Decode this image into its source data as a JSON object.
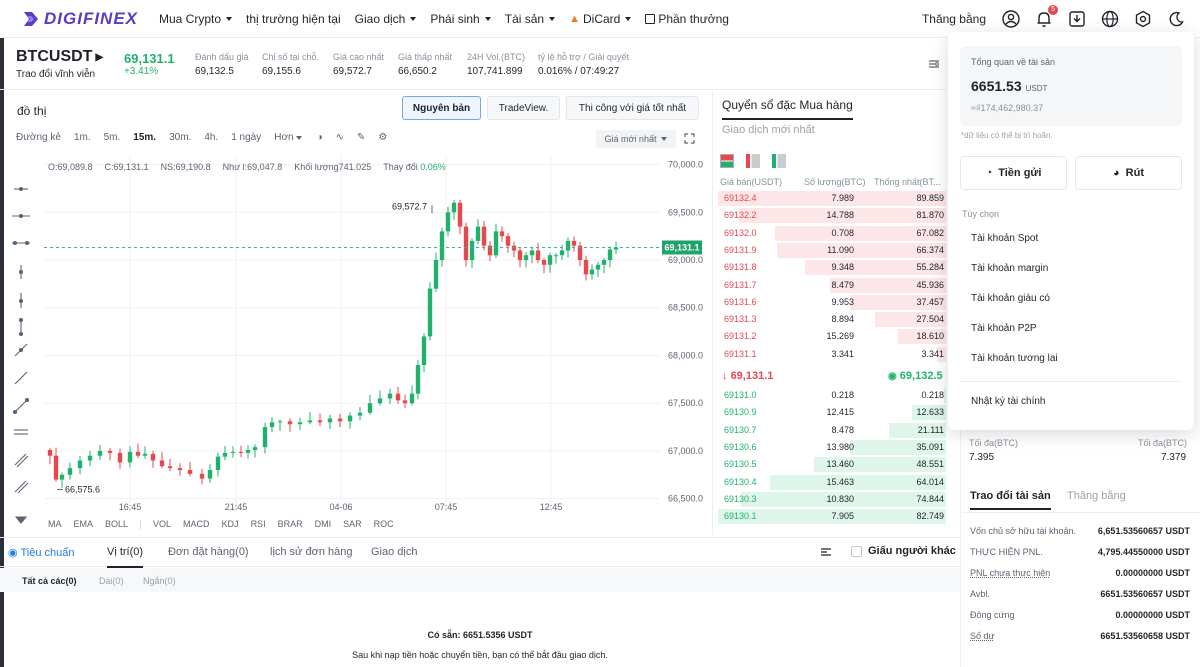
{
  "brand": {
    "name": "DIGIFINEX"
  },
  "nav": {
    "items": [
      {
        "label": "Mua Crypto",
        "caret": true
      },
      {
        "label": "thị trường hiện tại",
        "caret": false
      },
      {
        "label": "Giao dịch",
        "caret": true
      },
      {
        "label": "Phái sinh",
        "caret": true
      },
      {
        "label": "Tài sản",
        "caret": true
      },
      {
        "label": "DiCard",
        "caret": true
      },
      {
        "label": "Phần thưởng",
        "caret": false
      }
    ],
    "right_label": "Thăng bằng",
    "notif_count": "5"
  },
  "ticker": {
    "symbol": "BTCUSDT",
    "subtitle": "Trao đổi vĩnh viễn",
    "price": "69,131.1",
    "change": "+3.41%",
    "stats": [
      {
        "label": "Đánh dấu giá",
        "value": "69,132.5"
      },
      {
        "label": "Chỉ số tại chỗ.",
        "value": "69,155.6"
      },
      {
        "label": "Giá cao nhất",
        "value": "69,572.7"
      },
      {
        "label": "Giá thấp nhất",
        "value": "66,650.2"
      },
      {
        "label": "24H Vol.(BTC)",
        "value": "107,741.899"
      },
      {
        "label": "tỷ lệ hỗ trợ / Giải quyết",
        "value": "0.016% / 07:49:27"
      }
    ]
  },
  "chart_panel": {
    "title": "đồ thị",
    "views": [
      "Nguyên bản",
      "TradeView.",
      "Thi công với giá tốt nhất"
    ],
    "timeframes": [
      "Đường kẻ",
      "1m.",
      "5m.",
      "15m.",
      "30m.",
      "4h.",
      "1 ngày",
      "Hơn"
    ],
    "active_tf": "15m.",
    "price_type": "Giá mới nhất",
    "ohlc": {
      "o": "O:69,089.8",
      "c": "C:69,131.1",
      "h": "NS:69,190.8",
      "l": "Như l:69,047.8",
      "vol": "Khối lượng741.025",
      "chg_label": "Thay đổi",
      "chg": "0.06%"
    },
    "indicators": [
      "MA",
      "EMA",
      "BOLL",
      "VOL",
      "MACD",
      "KDJ",
      "RSI",
      "BRAR",
      "DMI",
      "SAR",
      "ROC"
    ],
    "high_label": "69,572.7",
    "low_label": "66,575.6",
    "last_tag": "69,131.1"
  },
  "chart_data": {
    "type": "candlestick",
    "x_ticks": [
      "16:45",
      "21:45",
      "04-06",
      "07:45",
      "12:45"
    ],
    "y_ticks": [
      "70,000.0",
      "69,500.0",
      "69,000.0",
      "68,500.0",
      "68,000.0",
      "67,500.0",
      "67,000.0",
      "66,500.0"
    ],
    "ylim": [
      66350,
      70100
    ],
    "last_price": 69131.1,
    "high": 69572.7,
    "low": 66575.6
  },
  "orderbook": {
    "title": "Quyển sổ đặc Mua hàng",
    "subtitle": "Giao dịch mới nhất",
    "headers": [
      "Giá bán(USDT)",
      "Số lượng(BTC)",
      "Thống nhất(BT..."
    ],
    "asks": [
      [
        "69132.4",
        "7.989",
        "89.859",
        1.0
      ],
      [
        "69132.2",
        "14.788",
        "81.870",
        0.91
      ],
      [
        "69132.0",
        "0.708",
        "67.082",
        0.75
      ],
      [
        "69131.9",
        "11.090",
        "66.374",
        0.74
      ],
      [
        "69131.8",
        "9.348",
        "55.284",
        0.62
      ],
      [
        "69131.7",
        "8.479",
        "45.936",
        0.51
      ],
      [
        "69131.6",
        "9.953",
        "37.457",
        0.42
      ],
      [
        "69131.3",
        "8.894",
        "27.504",
        0.31
      ],
      [
        "69131.2",
        "15.269",
        "18.610",
        0.21
      ],
      [
        "69131.1",
        "3.341",
        "3.341",
        0.04
      ]
    ],
    "mid_price": "69,131.1",
    "mark_price": "69,132.5",
    "bids": [
      [
        "69131.0",
        "0.218",
        "0.218",
        0.01
      ],
      [
        "69130.9",
        "12.415",
        "12.633",
        0.15
      ],
      [
        "69130.7",
        "8.478",
        "21.111",
        0.25
      ],
      [
        "69130.6",
        "13.980",
        "35.091",
        0.42
      ],
      [
        "69130.5",
        "13.460",
        "48.551",
        0.58
      ],
      [
        "69130.4",
        "15.463",
        "64.014",
        0.77
      ],
      [
        "69130.3",
        "10.830",
        "74.844",
        0.9
      ],
      [
        "69130.1",
        "7.905",
        "82.749",
        1.0
      ]
    ]
  },
  "bottom": {
    "tabs": [
      "Tiêu chuẩn",
      "Vị trí(0)",
      "Đơn đặt hàng(0)",
      "lịch sử đơn hàng",
      "Giao dịch"
    ],
    "hide_others": "Giấu người khác",
    "subtabs": [
      "Tất cả các(0)",
      "Dài(0)",
      "Ngắn(0)"
    ],
    "available": "Có sẵn: 6651.5356 USDT",
    "hint": "Sau khi nạp tiền hoặc chuyển tiền, bạn có thể bắt đầu giao dịch."
  },
  "right_panel": {
    "max_label_1": "Tối đa(BTC)",
    "max_value_1": "7.395",
    "max_label_2": "Tối đa(BTC)",
    "max_value_2": "7.379",
    "tab_active": "Trao đổi tài sản",
    "tab_other": "Thăng bằng",
    "rows": [
      {
        "label": "Vốn chủ sở hữu tài khoản.",
        "value": "6,651.53560657 USDT"
      },
      {
        "label": "THỰC HIỆN PNL.",
        "value": "4,795.44550000 USDT"
      },
      {
        "label": "PNL chưa thực hiện",
        "value": "0.00000000 USDT"
      },
      {
        "label": "Avbl.",
        "value": "6651.53560657 USDT"
      },
      {
        "label": "Đông cứng",
        "value": "0.00000000 USDT"
      },
      {
        "label": "Số dư",
        "value": "6651.53560658 USDT"
      }
    ]
  },
  "dropdown": {
    "overview_label": "Tổng quan về tài sản",
    "total": "6651.53",
    "unit": "USDT",
    "fiat": "≈₫174,462,980.37",
    "note": "*dữ liệu có thể bị trì hoãn.",
    "deposit": "Tiền gửi",
    "withdraw": "Rút",
    "options_label": "Tùy chọn",
    "items": [
      "Tài khoản Spot",
      "Tài khoản margin",
      "Tài khoản giàu có",
      "Tài khoản P2P",
      "Tài khoản tương lai"
    ],
    "log": "Nhật ký tài chính"
  },
  "colors": {
    "up": "#20b26c",
    "down": "#e5484d",
    "brand": "#5b3cc4",
    "accent": "#1e7de6"
  }
}
